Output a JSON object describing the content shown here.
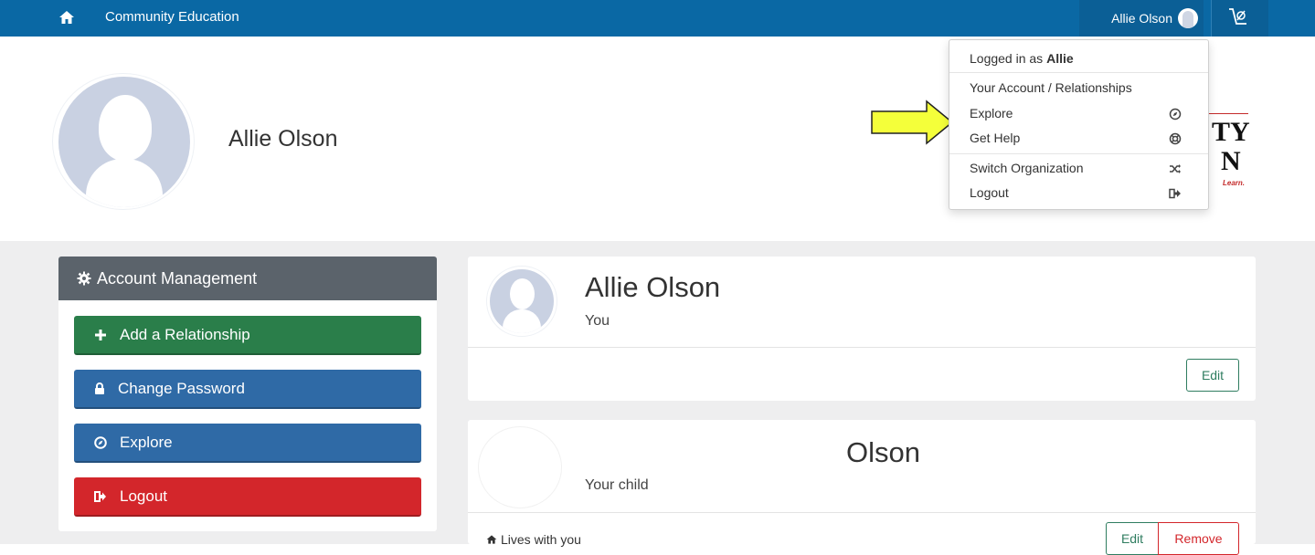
{
  "topbar": {
    "brand": "Community Education",
    "user_name": "Allie Olson"
  },
  "header": {
    "name": "Allie Olson",
    "logo_line1": "TY",
    "logo_line2": "N",
    "logo_tag": "Learn."
  },
  "dropdown": {
    "logged_in_prefix": "Logged in as ",
    "logged_in_user": "Allie",
    "items": [
      {
        "label": "Your Account / Relationships"
      },
      {
        "label": "Explore",
        "icon": "compass-icon"
      },
      {
        "label": "Get Help",
        "icon": "lifebuoy-icon"
      },
      {
        "label": "Switch Organization",
        "icon": "shuffle-icon"
      },
      {
        "label": "Logout",
        "icon": "logout-icon"
      }
    ]
  },
  "sidebar": {
    "title": "Account Management",
    "buttons": [
      {
        "label": "Add a Relationship",
        "color": "#2a7e4a"
      },
      {
        "label": "Change Password",
        "color": "#2f6aa6"
      },
      {
        "label": "Explore",
        "color": "#2f6aa6"
      },
      {
        "label": "Logout",
        "color": "#d3262b"
      }
    ]
  },
  "cards": [
    {
      "name": "Allie Olson",
      "relation": "You",
      "edit_label": "Edit"
    },
    {
      "name": "Olson",
      "relation": "Your child",
      "lives": "Lives with you",
      "edit_label": "Edit",
      "remove_label": "Remove"
    }
  ],
  "colors": {
    "topbar": "#0a68a4",
    "success": "#2a7e4a",
    "primary": "#2f6aa6",
    "danger": "#d3262b",
    "highlight_arrow": "#f4ff3a"
  }
}
